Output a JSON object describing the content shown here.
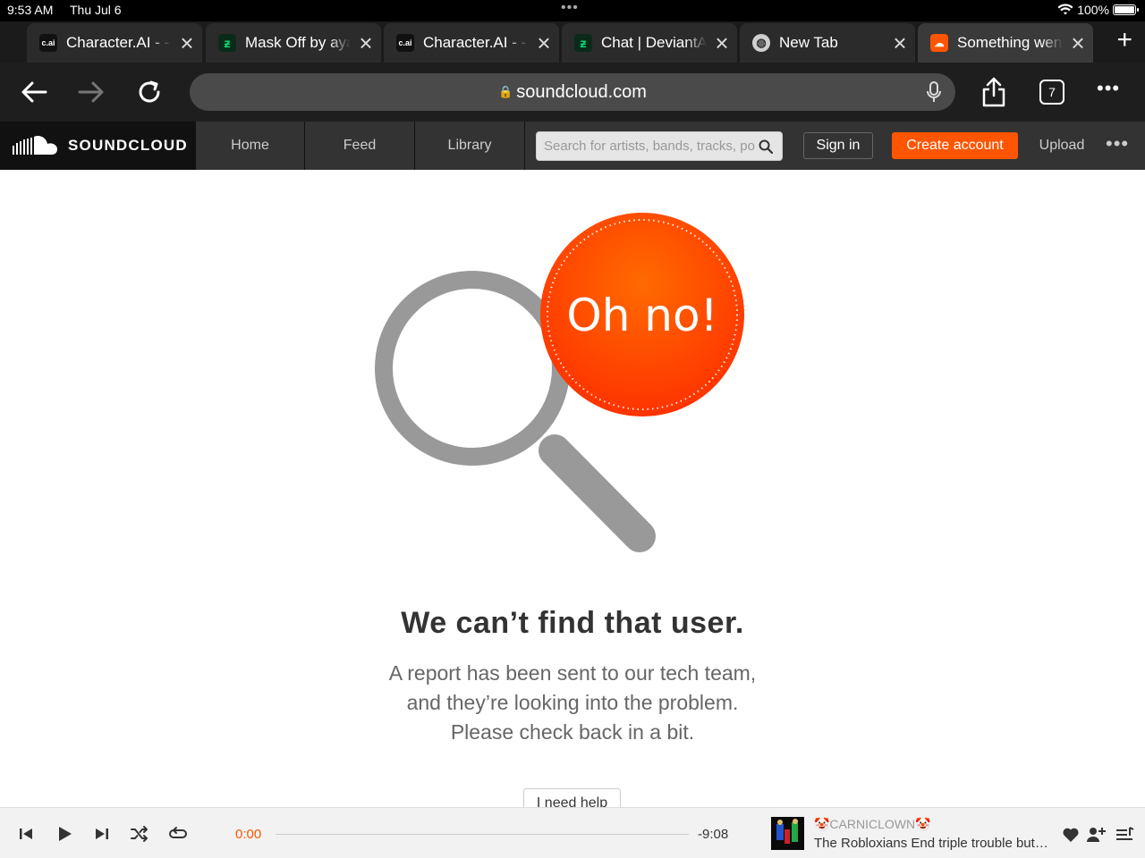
{
  "status_bar": {
    "time": "9:53 AM",
    "date": "Thu Jul 6",
    "battery": "100%"
  },
  "tabs": [
    {
      "title": "Character.AI - - ",
      "favicon": "c.ai"
    },
    {
      "title": "Mask Off by ayano",
      "favicon": "deviantart-icon"
    },
    {
      "title": "Character.AI - - ",
      "favicon": "c.ai"
    },
    {
      "title": "Chat | DeviantArt",
      "favicon": "deviantart-icon"
    },
    {
      "title": "New Tab",
      "favicon": "globe-icon"
    },
    {
      "title": "Something went wrong",
      "favicon": "soundcloud-icon"
    }
  ],
  "toolbar": {
    "url": "soundcloud.com",
    "tab_count": "7"
  },
  "header": {
    "logo": "SOUNDCLOUD",
    "nav": [
      "Home",
      "Feed",
      "Library"
    ],
    "search_placeholder": "Search for artists, bands, tracks, podcasts",
    "sign_in": "Sign in",
    "create_account": "Create account",
    "upload": "Upload"
  },
  "error": {
    "badge": "Oh no!",
    "title": "We can’t find that user.",
    "body": [
      "A report has been sent to our tech team,",
      "and they’re looking into the problem.",
      "Please check back in a bit."
    ],
    "help_button": "I need help"
  },
  "player": {
    "time_current": "0:00",
    "time_remaining": "-9:08",
    "artist": "🤡CARNICLOWN🤡",
    "track": "The Robloxians End triple trouble but it's a robloxian cover"
  },
  "colors": {
    "accent": "#ff5500",
    "header_bg": "#333333",
    "logo_bg": "#111111"
  }
}
